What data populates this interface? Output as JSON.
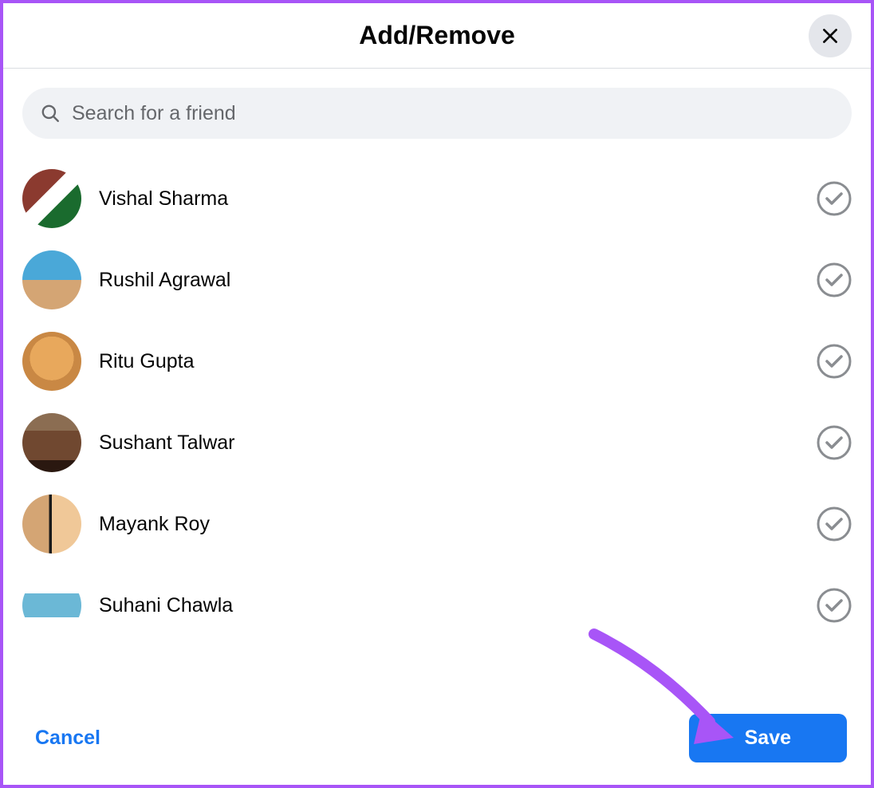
{
  "header": {
    "title": "Add/Remove"
  },
  "search": {
    "placeholder": "Search for a friend"
  },
  "friends": [
    {
      "name": "Vishal Sharma",
      "avatar_class": "av0"
    },
    {
      "name": "Rushil Agrawal",
      "avatar_class": "av1"
    },
    {
      "name": "Ritu Gupta",
      "avatar_class": "av2"
    },
    {
      "name": "Sushant Talwar",
      "avatar_class": "av3"
    },
    {
      "name": "Mayank Roy",
      "avatar_class": "av4"
    },
    {
      "name": "Suhani Chawla",
      "avatar_class": "av5"
    }
  ],
  "footer": {
    "cancel_label": "Cancel",
    "save_label": "Save"
  },
  "colors": {
    "accent_blue": "#1877f2",
    "border_purple": "#a855f7",
    "search_bg": "#f0f2f5",
    "text_secondary": "#65676b"
  }
}
